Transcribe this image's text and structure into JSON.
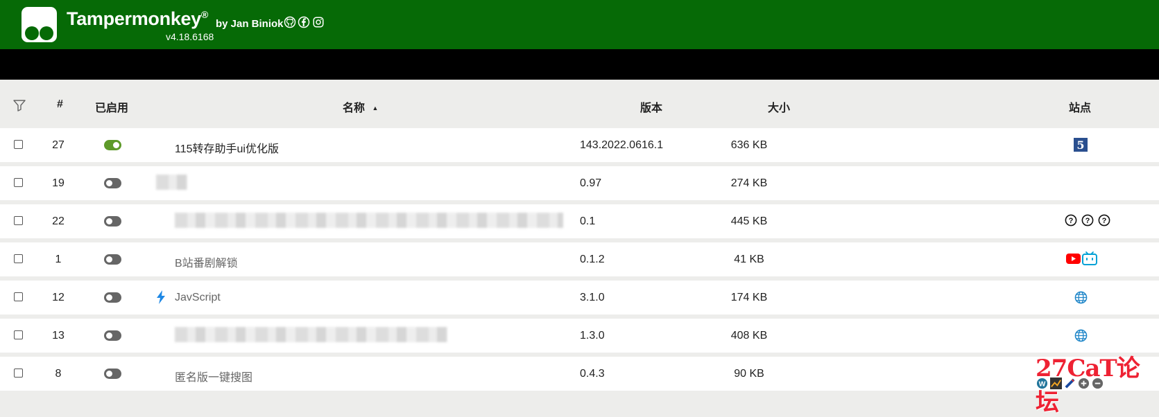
{
  "header": {
    "title": "Tampermonkey",
    "reg_mark": "®",
    "by": "by Jan Biniok",
    "version": "v4.18.6168",
    "social_icons": [
      "github-icon",
      "facebook-icon",
      "instagram-icon"
    ],
    "background": "#066a06"
  },
  "table": {
    "columns": {
      "filter": "filter-icon",
      "number": "#",
      "enabled": "已启用",
      "name": "名称",
      "sort_indicator": "▲",
      "version": "版本",
      "size": "大小",
      "sites": "站点"
    },
    "rows": [
      {
        "num": "27",
        "enabled": true,
        "name": "115转存助手ui优化版",
        "version": "143.2022.0616.1",
        "size": "636 KB",
        "sites": [
          "site-5-icon"
        ]
      },
      {
        "num": "19",
        "enabled": false,
        "name": "",
        "blurred": true,
        "version": "0.97",
        "size": "274 KB",
        "sites": []
      },
      {
        "num": "22",
        "enabled": false,
        "name": "",
        "blurred": true,
        "version": "0.1",
        "size": "445 KB",
        "sites": [
          "question-icon",
          "question-icon",
          "question-icon"
        ]
      },
      {
        "num": "1",
        "enabled": false,
        "name": "B站番剧解锁",
        "version": "0.1.2",
        "size": "41 KB",
        "sites": [
          "youtube-icon",
          "bilibili-icon"
        ]
      },
      {
        "num": "12",
        "enabled": false,
        "name": "JavScript",
        "version": "3.1.0",
        "size": "174 KB",
        "sites": [
          "globe-icon"
        ],
        "has_bolt": true
      },
      {
        "num": "13",
        "enabled": false,
        "name": "",
        "blurred": true,
        "version": "1.3.0",
        "size": "408 KB",
        "sites": [
          "globe-icon"
        ]
      },
      {
        "num": "8",
        "enabled": false,
        "name": "匿名版一键搜图",
        "version": "0.4.3",
        "size": "90 KB",
        "sites": [
          "wordpress-icon",
          "site-icon",
          "site-icon",
          "site-icon",
          "site-icon"
        ]
      }
    ]
  },
  "watermark": "27CaT论坛",
  "colors": {
    "toggle_on": "#5e9a2a",
    "toggle_off": "#666666",
    "black_bar": "#000000",
    "row_bg": "#ffffff",
    "page_bg": "#ededeb"
  }
}
